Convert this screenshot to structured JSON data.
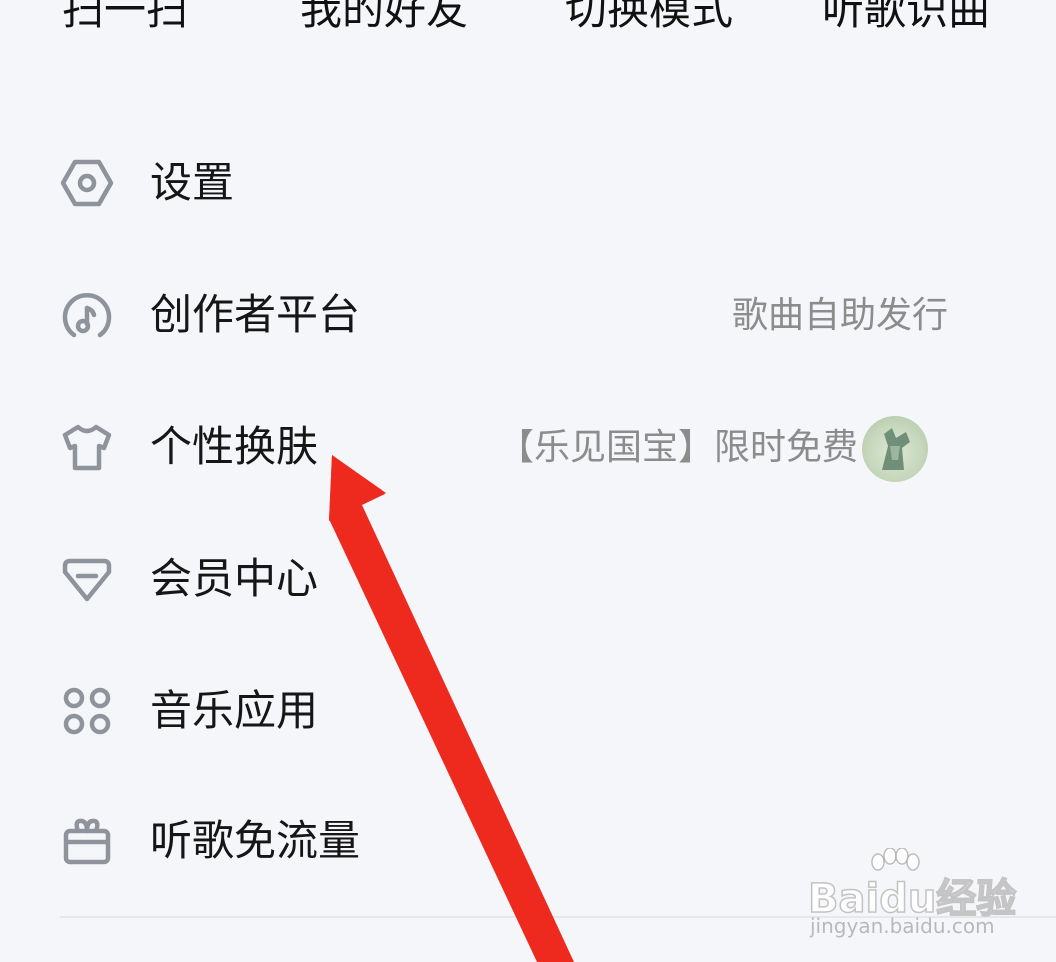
{
  "top_tabs": [
    "扫一扫",
    "我的好友",
    "切换模式",
    "听歌识曲"
  ],
  "menu": [
    {
      "label": "设置",
      "hint": "",
      "icon": "settings-hexagon-icon"
    },
    {
      "label": "创作者平台",
      "hint": "歌曲自助发行",
      "icon": "creator-music-icon"
    },
    {
      "label": "个性换肤",
      "hint": "【乐见国宝】限时免费",
      "icon": "tshirt-icon",
      "thumbnail": "skin-thumbnail"
    },
    {
      "label": "会员中心",
      "hint": "",
      "icon": "vip-diamond-icon"
    },
    {
      "label": "音乐应用",
      "hint": "",
      "icon": "apps-grid-icon"
    },
    {
      "label": "听歌免流量",
      "hint": "",
      "icon": "gift-icon"
    }
  ],
  "watermark": {
    "brand": "Baidu经验",
    "url": "jingyan.baidu.com"
  },
  "colors": {
    "background": "#f5f6fa",
    "icon": "#8e939c",
    "hint": "#8c8c8c",
    "arrow": "#ee2a1f"
  }
}
